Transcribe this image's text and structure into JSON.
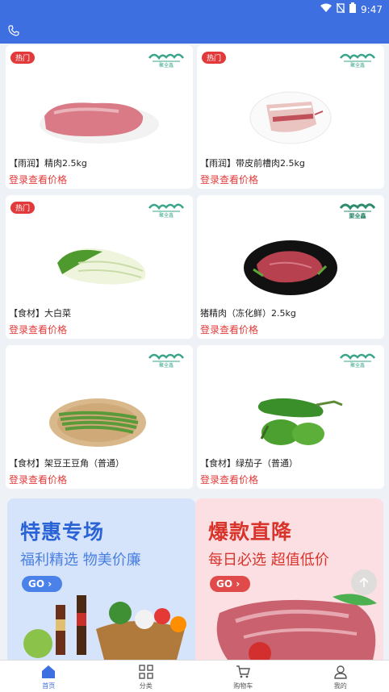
{
  "status_bar": {
    "time": "9:47"
  },
  "products": [
    {
      "hot": "热门",
      "name": "【雨润】精肉2.5kg",
      "price": "登录查看价格",
      "image": "pork-lean"
    },
    {
      "hot": "热门",
      "name": "【雨润】带皮前槽肉2.5kg",
      "price": "登录查看价格",
      "image": "pork-belly"
    },
    {
      "hot": "热门",
      "name": "【食材】大白菜",
      "price": "登录查看价格",
      "image": "napa-cabbage"
    },
    {
      "hot": "",
      "name": "猪精肉（冻化鲜）2.5kg",
      "price": "登录查看价格",
      "image": "pork-plate"
    },
    {
      "hot": "",
      "name": "【食材】架豆王豆角（普通）",
      "price": "登录查看价格",
      "image": "green-beans"
    },
    {
      "hot": "",
      "name": "【食材】绿茄子（普通）",
      "price": "登录查看价格",
      "image": "green-eggplant"
    }
  ],
  "banners": [
    {
      "title": "特惠专场",
      "subtitle": "福利精选 物美价廉",
      "go": "GO",
      "title_color": "#2a63d6",
      "bg": "#d6e4fb"
    },
    {
      "title": "爆款直降",
      "subtitle": "每日必选 超值低价",
      "go": "GO",
      "title_color": "#d9342b",
      "bg": "#fbdfe2"
    }
  ],
  "tabbar": [
    {
      "label": "首页",
      "icon": "home-icon",
      "active": true
    },
    {
      "label": "分类",
      "icon": "category-icon",
      "active": false
    },
    {
      "label": "购物车",
      "icon": "cart-icon",
      "active": false
    },
    {
      "label": "我的",
      "icon": "user-icon",
      "active": false
    }
  ],
  "colors": {
    "primary": "#3d6fe0",
    "price_red": "#e23a3a"
  }
}
